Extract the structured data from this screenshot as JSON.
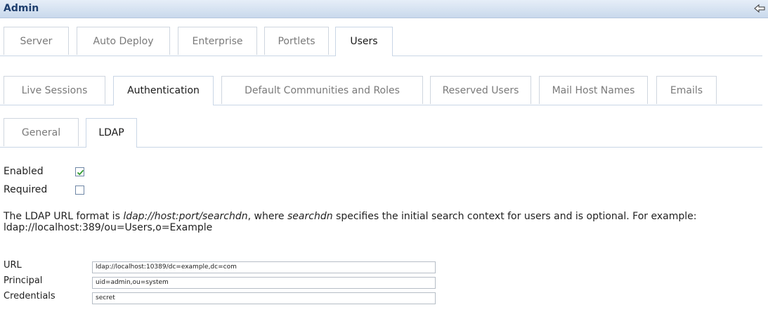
{
  "header": {
    "title": "Admin"
  },
  "tabs_main": [
    "Server",
    "Auto Deploy",
    "Enterprise",
    "Portlets",
    "Users"
  ],
  "tabs_users": [
    "Live Sessions",
    "Authentication",
    "Default Communities and Roles",
    "Reserved Users",
    "Mail Host Names",
    "Emails"
  ],
  "tabs_auth": [
    "General",
    "LDAP"
  ],
  "options": {
    "enabled_label": "Enabled",
    "enabled_checked": true,
    "required_label": "Required",
    "required_checked": false
  },
  "description": {
    "p1": "The LDAP URL format is ",
    "em1": "ldap://host:port/searchdn",
    "p2": ", where ",
    "em2": "searchdn",
    "p3": " specifies the initial search context for users and is optional. For example: ldap://localhost:389/ou=Users,o=Example"
  },
  "fields": {
    "url_label": "URL",
    "url_value": "ldap://localhost:10389/dc=example,dc=com",
    "principal_label": "Principal",
    "principal_value": "uid=admin,ou=system",
    "credentials_label": "Credentials",
    "credentials_value": "secret"
  }
}
